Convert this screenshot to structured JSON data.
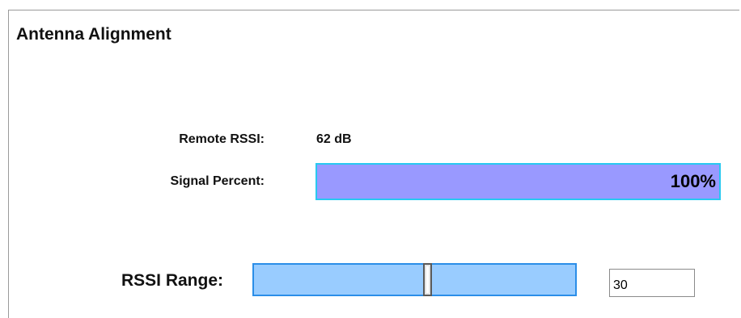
{
  "page": {
    "title": "Antenna Alignment"
  },
  "remote_rssi": {
    "label": "Remote RSSI:",
    "value": "62 dB"
  },
  "signal_percent": {
    "label": "Signal Percent:",
    "display": "100%",
    "fraction": 1.0,
    "fill_color": "#9999ff",
    "border_color": "#28c8f0"
  },
  "rssi_range": {
    "label": "RSSI Range:",
    "input_value": "30",
    "slider_fraction": 0.54,
    "track_color": "#99ccff",
    "track_border_color": "#2b8ee8"
  }
}
